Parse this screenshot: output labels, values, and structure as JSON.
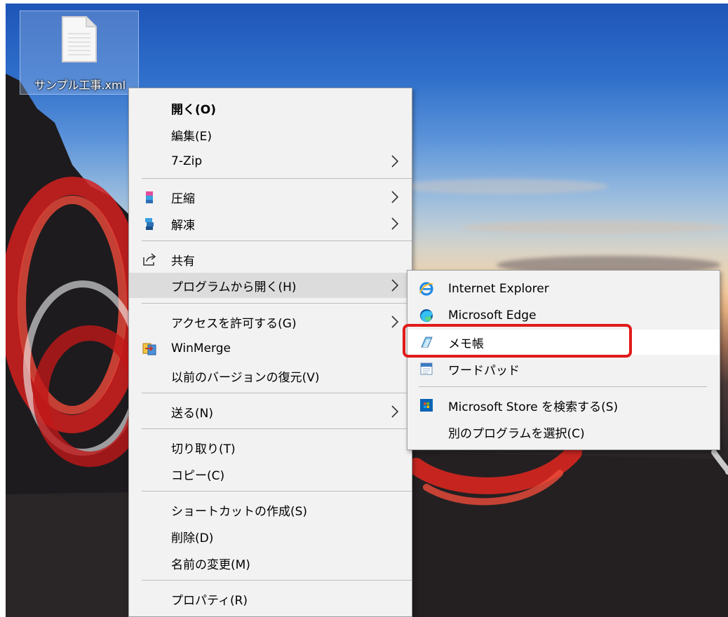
{
  "desktop": {
    "file_icon": {
      "name": "サンプル工事.xml",
      "icon": "document-icon"
    }
  },
  "context_menu": {
    "items": [
      {
        "label": "開く(O)",
        "bold": true
      },
      {
        "label": "編集(E)"
      },
      {
        "label": "7-Zip",
        "submenu": true
      },
      {
        "label": "圧縮",
        "icon": "compress-icon",
        "submenu": true
      },
      {
        "label": "解凍",
        "icon": "extract-icon",
        "submenu": true
      },
      {
        "label": "共有",
        "icon": "share-icon"
      },
      {
        "label": "プログラムから開く(H)",
        "submenu": true,
        "highlighted": true
      },
      {
        "label": "アクセスを許可する(G)",
        "submenu": true
      },
      {
        "label": "WinMerge",
        "icon": "winmerge-icon"
      },
      {
        "label": "以前のバージョンの復元(V)"
      },
      {
        "label": "送る(N)",
        "submenu": true
      },
      {
        "label": "切り取り(T)"
      },
      {
        "label": "コピー(C)"
      },
      {
        "label": "ショートカットの作成(S)"
      },
      {
        "label": "削除(D)"
      },
      {
        "label": "名前の変更(M)"
      },
      {
        "label": "プロパティ(R)"
      }
    ]
  },
  "open_with_submenu": {
    "items": [
      {
        "label": "Internet Explorer",
        "icon": "internet-explorer-icon"
      },
      {
        "label": "Microsoft Edge",
        "icon": "microsoft-edge-icon"
      },
      {
        "label": "メモ帳",
        "icon": "notepad-icon",
        "highlighted": true
      },
      {
        "label": "ワードパッド",
        "icon": "wordpad-icon"
      },
      {
        "label": "Microsoft Store を検索する(S)",
        "icon": "microsoft-store-icon"
      },
      {
        "label": "別のプログラムを選択(C)"
      }
    ]
  },
  "annotation": {
    "highlight_color": "#e11a1a"
  }
}
